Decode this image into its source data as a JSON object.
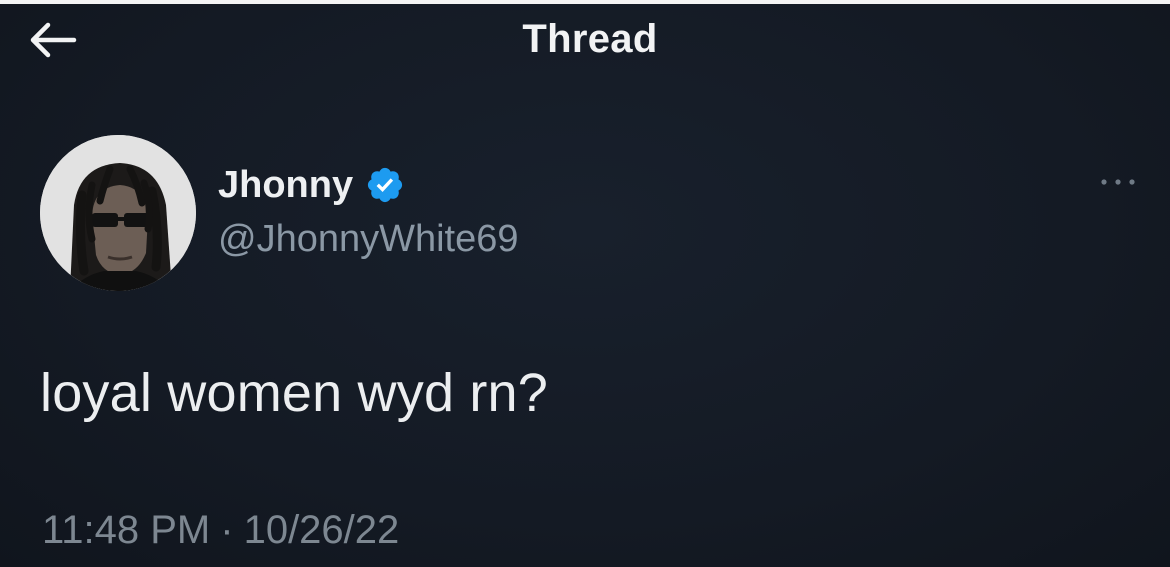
{
  "header": {
    "title": "Thread",
    "back_icon": "arrow-left-icon"
  },
  "tweet": {
    "author": {
      "display_name": "Jhonny",
      "handle": "@JhonnyWhite69",
      "verified": true,
      "verified_icon": "verified-badge-icon",
      "avatar_icon": "avatar"
    },
    "more_icon": "more-options-icon",
    "text": "loyal women wyd rn?",
    "time": "11:48 PM",
    "separator": "·",
    "date": "10/26/22"
  },
  "colors": {
    "background": "#151c27",
    "verified_blue": "#1d9bf0",
    "primary_text": "#e7e9ea",
    "secondary_text": "#8b98a5"
  }
}
